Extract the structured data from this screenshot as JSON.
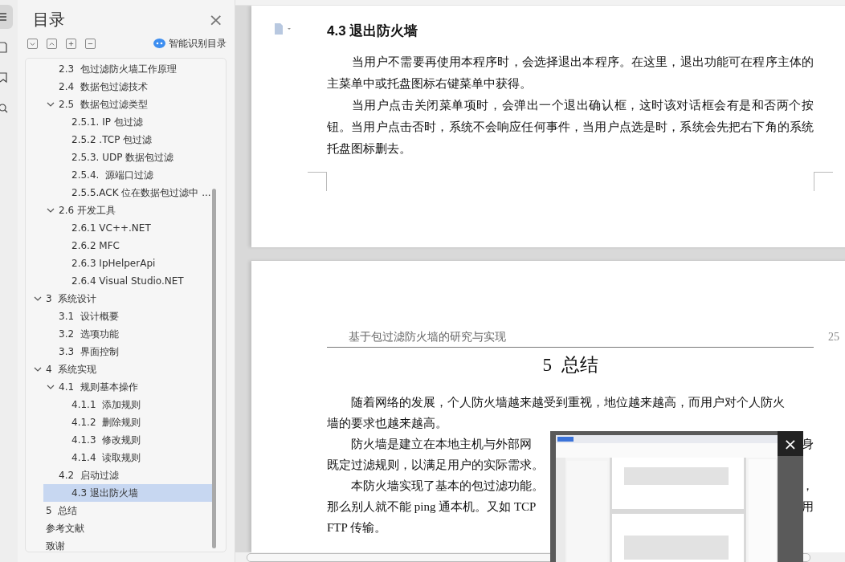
{
  "sidebar": {
    "title": "目录",
    "close_label": "×",
    "smart_toc_label": "智能识别目录",
    "toc": {
      "partial_branch": [
        {
          "label": "2.3  包过滤防火墙工作原理",
          "selected": false
        },
        {
          "label": "2.4  数据包过滤技术",
          "selected": false
        },
        {
          "label": "2.5  数据包过滤类型",
          "selected": false,
          "expanded": true,
          "children": [
            {
              "label": "2.5.1. IP 包过滤",
              "selected": false
            },
            {
              "label": "2.5.2 .TCP 包过滤",
              "selected": false
            },
            {
              "label": "2.5.3. UDP 数据包过滤",
              "selected": false
            },
            {
              "label": "2.5.4.  源端口过滤",
              "selected": false
            },
            {
              "label": "2.5.5.ACK 位在数据包过滤中 ...",
              "selected": false
            }
          ]
        },
        {
          "label": "2.6 开发工具",
          "selected": false,
          "expanded": true,
          "children": [
            {
              "label": "2.6.1 VC++.NET",
              "selected": false
            },
            {
              "label": "2.6.2 MFC",
              "selected": false
            },
            {
              "label": "2.6.3 IpHelperApi",
              "selected": false
            },
            {
              "label": "2.6.4 Visual Studio.NET",
              "selected": false
            }
          ]
        }
      ],
      "items": [
        {
          "label": "3  系统设计",
          "selected": false,
          "expanded": true,
          "children": [
            {
              "label": "3.1  设计概要",
              "selected": false
            },
            {
              "label": "3.2  选项功能",
              "selected": false
            },
            {
              "label": "3.3  界面控制",
              "selected": false
            }
          ]
        },
        {
          "label": "4  系统实现",
          "selected": false,
          "expanded": true,
          "children": [
            {
              "label": "4.1  规则基本操作",
              "selected": false,
              "expanded": true,
              "children": [
                {
                  "label": "4.1.1  添加规则",
                  "selected": false
                },
                {
                  "label": "4.1.2  删除规则",
                  "selected": false
                },
                {
                  "label": "4.1.3  修改规则",
                  "selected": false
                },
                {
                  "label": "4.1.4  读取规则",
                  "selected": false
                }
              ]
            },
            {
              "label": "4.2  启动过滤",
              "selected": false
            },
            {
              "label": "4.3 退出防火墙",
              "selected": true
            }
          ]
        },
        {
          "label": "5  总结",
          "selected": false
        },
        {
          "label": "参考文献",
          "selected": false
        },
        {
          "label": "致谢",
          "selected": false
        }
      ]
    }
  },
  "page_1": {
    "heading": "4.3 退出防火墙",
    "paragraphs": [
      "当用户不需要再使用本程序时，会选择退出本程序。在这里，退出功能可在程序主体的主菜单中或托盘图标右键菜单中获得。",
      "当用户点击关闭菜单项时，会弹出一个退出确认框，这时该对话框会有是和否两个按钮。当用户点击否时，系统不会响应任何事件，当用户点选是时，系统会先把右下角的系统托盘图标删去。"
    ]
  },
  "page_2": {
    "header": "基于包过滤防火墙的研究与实现",
    "page_number": "25",
    "title": "5  总结",
    "lines": [
      {
        "indent": true,
        "text": "随着网络的发展，个人防火墙越来越受到重视，地位越来越高，而用户对个人防火"
      },
      {
        "indent": false,
        "text": "墙的要求也越来越高。"
      },
      {
        "indent": true,
        "text": "防火墙是建立在本地主机与外部网",
        "right": "身"
      },
      {
        "indent": false,
        "text": "既定过滤规则，以满足用户的实际需求。"
      },
      {
        "indent": true,
        "text": "本防火墙实现了基本的包过滤功能。",
        "right": "，"
      },
      {
        "indent": false,
        "text": "那么别人就不能 ping 通本机。又如 TCP",
        "right": "用"
      },
      {
        "indent": false,
        "text": "FTP 传输。"
      }
    ]
  },
  "preview": {
    "kind": "picture",
    "close_label": "×"
  }
}
